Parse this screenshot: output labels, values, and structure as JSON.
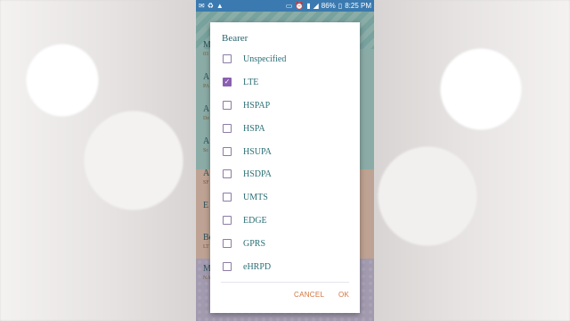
{
  "status_bar": {
    "battery": "86%",
    "time": "8:25 PM",
    "left_icons": [
      "email-icon",
      "recycle-icon",
      "warning-icon"
    ],
    "right_icons": [
      "screen-mirror-icon",
      "alarm-icon",
      "sim-icon",
      "signal-icon"
    ]
  },
  "background_list": {
    "items": [
      {
        "label": "M",
        "sub": "03"
      },
      {
        "label": "A",
        "sub": "PA"
      },
      {
        "label": "A",
        "sub": "De"
      },
      {
        "label": "A",
        "sub": "Sc"
      },
      {
        "label": "A",
        "sub": "SF"
      },
      {
        "label": "E",
        "sub": ""
      },
      {
        "label": "Be",
        "sub": "LT"
      },
      {
        "label": "M",
        "sub": "NA"
      }
    ]
  },
  "dialog": {
    "title": "Bearer",
    "options": [
      {
        "label": "Unspecified",
        "checked": false
      },
      {
        "label": "LTE",
        "checked": true
      },
      {
        "label": "HSPAP",
        "checked": false
      },
      {
        "label": "HSPA",
        "checked": false
      },
      {
        "label": "HSUPA",
        "checked": false
      },
      {
        "label": "HSDPA",
        "checked": false
      },
      {
        "label": "UMTS",
        "checked": false
      },
      {
        "label": "EDGE",
        "checked": false
      },
      {
        "label": "GPRS",
        "checked": false
      },
      {
        "label": "eHRPD",
        "checked": false
      }
    ],
    "cancel_label": "CANCEL",
    "ok_label": "OK",
    "check_mark": "✓"
  },
  "colors": {
    "status_bar": "#3a7ab0",
    "accent_checkbox": "#8a5fb0",
    "button_text": "#d2733e",
    "option_text": "#2a6f75"
  }
}
